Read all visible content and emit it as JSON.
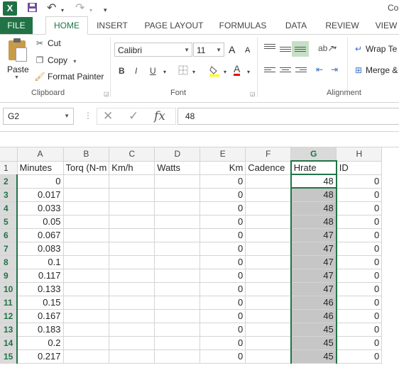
{
  "app": {
    "logo": "X",
    "title": "Co"
  },
  "qat": {
    "save_icon": "floppy-icon",
    "undo": "↶",
    "redo": "↷",
    "more": "▾"
  },
  "tabs": [
    "FILE",
    "HOME",
    "INSERT",
    "PAGE LAYOUT",
    "FORMULAS",
    "DATA",
    "REVIEW",
    "VIEW"
  ],
  "ribbon": {
    "clipboard": {
      "paste": "Paste",
      "cut": "Cut",
      "copy": "Copy",
      "format_painter": "Format Painter",
      "label": "Clipboard"
    },
    "font": {
      "name": "Calibri",
      "size": "11",
      "grow": "A",
      "shrink": "A",
      "bold": "B",
      "italic": "I",
      "underline": "U",
      "font_color": "A",
      "label": "Font"
    },
    "alignment": {
      "wrap_text": "Wrap Te",
      "merge": "Merge &",
      "label": "Alignment"
    }
  },
  "formula_bar": {
    "name_box": "G2",
    "fx": "fx",
    "cancel": "✕",
    "enter": "✓",
    "value": "48"
  },
  "sheet": {
    "columns": [
      "A",
      "B",
      "C",
      "D",
      "E",
      "F",
      "G",
      "H"
    ],
    "selected_column": "G",
    "header_row": [
      "Minutes",
      "Torq (N-m",
      "Km/h",
      "Watts",
      "Km",
      "Cadence",
      "Hrate",
      "ID"
    ],
    "rows": [
      {
        "n": "2",
        "a": "0",
        "e": "0",
        "g": "48",
        "h": "0"
      },
      {
        "n": "3",
        "a": "0.017",
        "e": "0",
        "g": "48",
        "h": "0"
      },
      {
        "n": "4",
        "a": "0.033",
        "e": "0",
        "g": "48",
        "h": "0"
      },
      {
        "n": "5",
        "a": "0.05",
        "e": "0",
        "g": "48",
        "h": "0"
      },
      {
        "n": "6",
        "a": "0.067",
        "e": "0",
        "g": "47",
        "h": "0"
      },
      {
        "n": "7",
        "a": "0.083",
        "e": "0",
        "g": "47",
        "h": "0"
      },
      {
        "n": "8",
        "a": "0.1",
        "e": "0",
        "g": "47",
        "h": "0"
      },
      {
        "n": "9",
        "a": "0.117",
        "e": "0",
        "g": "47",
        "h": "0"
      },
      {
        "n": "10",
        "a": "0.133",
        "e": "0",
        "g": "47",
        "h": "0"
      },
      {
        "n": "11",
        "a": "0.15",
        "e": "0",
        "g": "46",
        "h": "0"
      },
      {
        "n": "12",
        "a": "0.167",
        "e": "0",
        "g": "46",
        "h": "0"
      },
      {
        "n": "13",
        "a": "0.183",
        "e": "0",
        "g": "45",
        "h": "0"
      },
      {
        "n": "14",
        "a": "0.2",
        "e": "0",
        "g": "45",
        "h": "0"
      },
      {
        "n": "15",
        "a": "0.217",
        "e": "0",
        "g": "45",
        "h": "0"
      }
    ]
  },
  "colors": {
    "accent": "#217346",
    "selection": "#c6c6c6"
  }
}
